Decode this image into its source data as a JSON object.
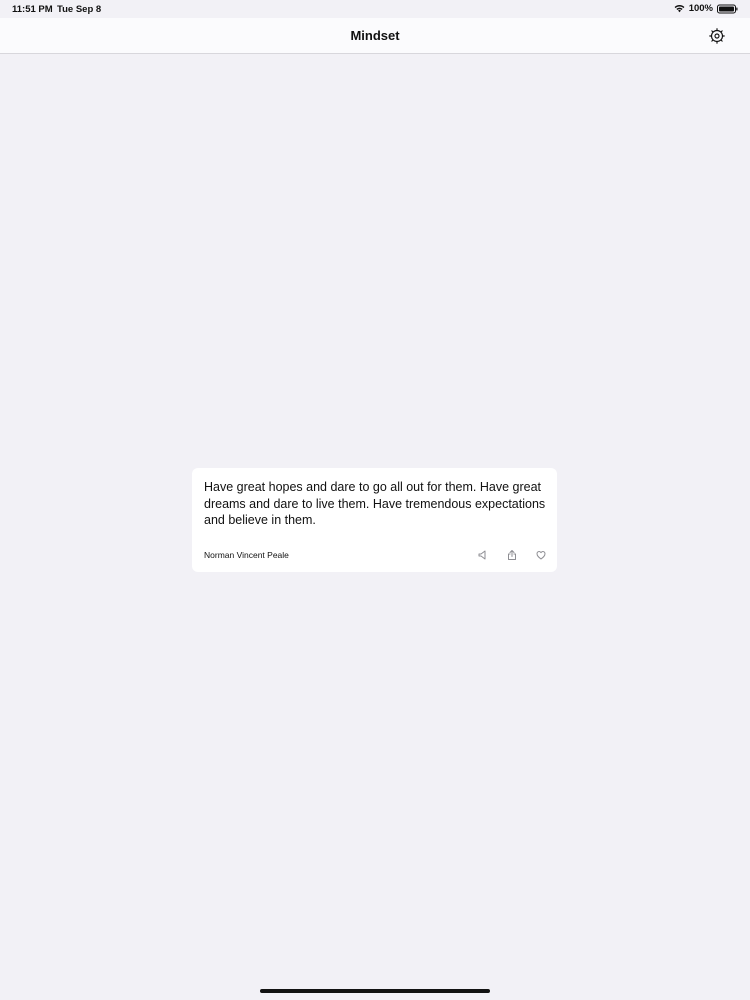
{
  "status_bar": {
    "time": "11:51 PM",
    "date": "Tue Sep 8",
    "battery": "100%"
  },
  "nav": {
    "title": "Mindset",
    "settings_icon": "gear-icon"
  },
  "quote_card": {
    "text": "Have great hopes and dare to go all out for them. Have great dreams and dare to live them. Have tremendous expectations and believe in them.",
    "author": "Norman Vincent Peale",
    "actions": [
      "speaker-icon",
      "share-icon",
      "heart-icon"
    ]
  },
  "colors": {
    "background": "#f2f1f6",
    "nav_background": "#fbfbfd",
    "card_background": "#ffffff",
    "text": "#111111",
    "icon": "#8e8e93"
  }
}
